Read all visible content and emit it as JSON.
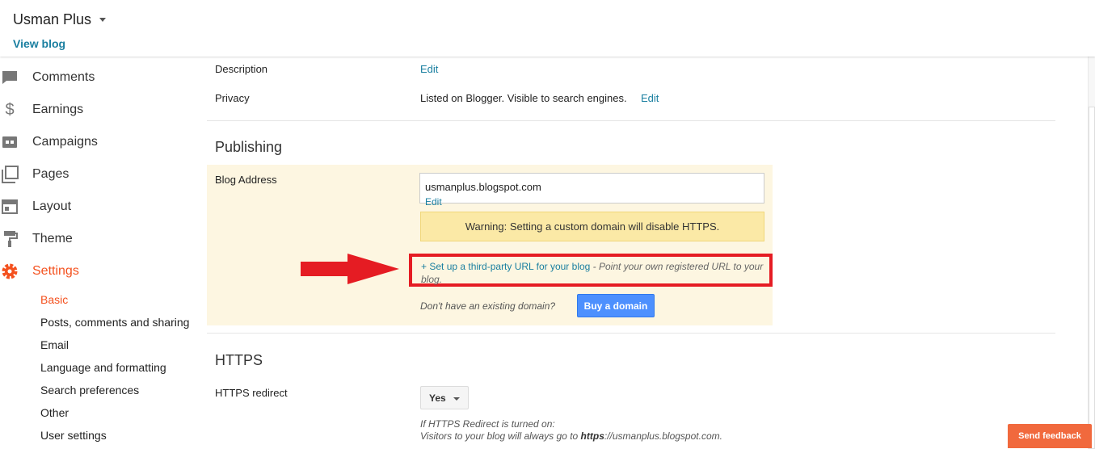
{
  "header": {
    "blog_name": "Usman Plus",
    "view_blog": "View blog"
  },
  "sidebar": {
    "items": [
      {
        "label": "Comments",
        "icon": "comment-icon"
      },
      {
        "label": "Earnings",
        "icon": "dollar-icon"
      },
      {
        "label": "Campaigns",
        "icon": "ad-icon"
      },
      {
        "label": "Pages",
        "icon": "pages-icon"
      },
      {
        "label": "Layout",
        "icon": "layout-icon"
      },
      {
        "label": "Theme",
        "icon": "paint-roller-icon"
      },
      {
        "label": "Settings",
        "icon": "gear-icon"
      }
    ],
    "sub_items": [
      "Basic",
      "Posts, comments and sharing",
      "Email",
      "Language and formatting",
      "Search preferences",
      "Other",
      "User settings"
    ]
  },
  "basic": {
    "description_label": "Description",
    "description_edit": "Edit",
    "privacy_label": "Privacy",
    "privacy_value": "Listed on Blogger. Visible to search engines.",
    "privacy_edit": "Edit"
  },
  "publishing": {
    "title": "Publishing",
    "blog_address_label": "Blog Address",
    "blog_address_value": "usmanplus.blogspot.com",
    "blog_address_edit": "Edit",
    "warning": "Warning: Setting a custom domain will disable HTTPS.",
    "third_party_link": "+ Set up a third-party URL for your blog",
    "third_party_desc": " - Point your own registered URL to your blog.",
    "no_domain": "Don't have an existing domain?",
    "buy_domain": "Buy a domain"
  },
  "https": {
    "title": "HTTPS",
    "redirect_label": "HTTPS redirect",
    "redirect_value": "Yes",
    "help_line1": "If HTTPS Redirect is turned on:",
    "help_line2_a": "Visitors to your blog will always go to ",
    "help_line2_b": "https",
    "help_line2_c": "://usmanplus.blogspot.com."
  },
  "feedback": "Send feedback",
  "colors": {
    "accent": "#f4511e",
    "link": "#1a7fa0",
    "highlight": "#e51c23",
    "panel": "#fdf6e1",
    "warning": "#fbe9a6",
    "button": "#4d90fe"
  }
}
